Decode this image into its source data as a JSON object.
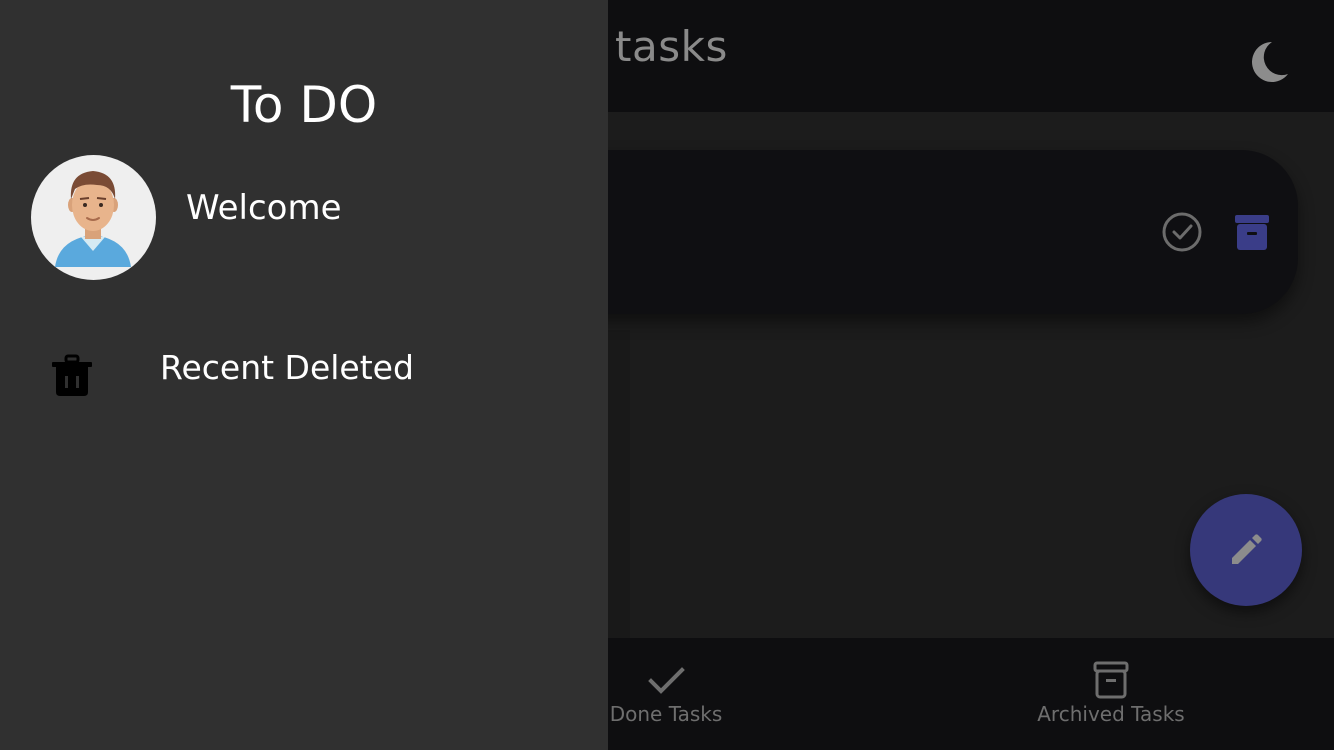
{
  "app": {
    "title": "New tasks",
    "visible_title": "ew tasks",
    "theme_toggle_icon": "moon-icon"
  },
  "task": {
    "done_icon": "check-circle-icon",
    "archive_icon": "archive-icon"
  },
  "fab": {
    "icon": "pencil-icon"
  },
  "bottom_nav": {
    "items": [
      {
        "label": "Done Tasks",
        "icon": "check-icon"
      },
      {
        "label": "Archived Tasks",
        "icon": "archive-icon"
      }
    ]
  },
  "drawer": {
    "title": "To DO",
    "welcome": "Welcome",
    "avatar_icon": "user-avatar",
    "items": [
      {
        "label": "Recent Deleted",
        "icon": "trash-icon"
      }
    ]
  },
  "colors": {
    "drawer_bg": "#303030",
    "appbar_bg": "#0e0e10",
    "accent": "#36387a",
    "text_primary": "#ffffff",
    "text_muted": "#6e6e6e"
  }
}
